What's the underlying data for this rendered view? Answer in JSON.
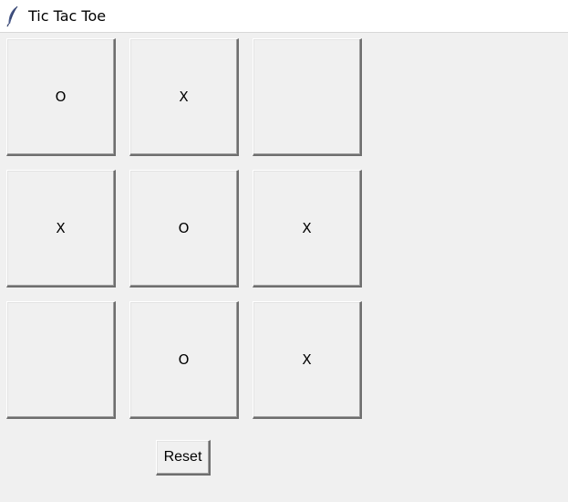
{
  "window": {
    "title": "Tic Tac Toe",
    "icon": "feather-icon"
  },
  "board": {
    "cells": [
      [
        "O",
        "X",
        ""
      ],
      [
        "X",
        "O",
        "X"
      ],
      [
        "",
        "O",
        "X"
      ]
    ]
  },
  "controls": {
    "reset_label": "Reset"
  }
}
